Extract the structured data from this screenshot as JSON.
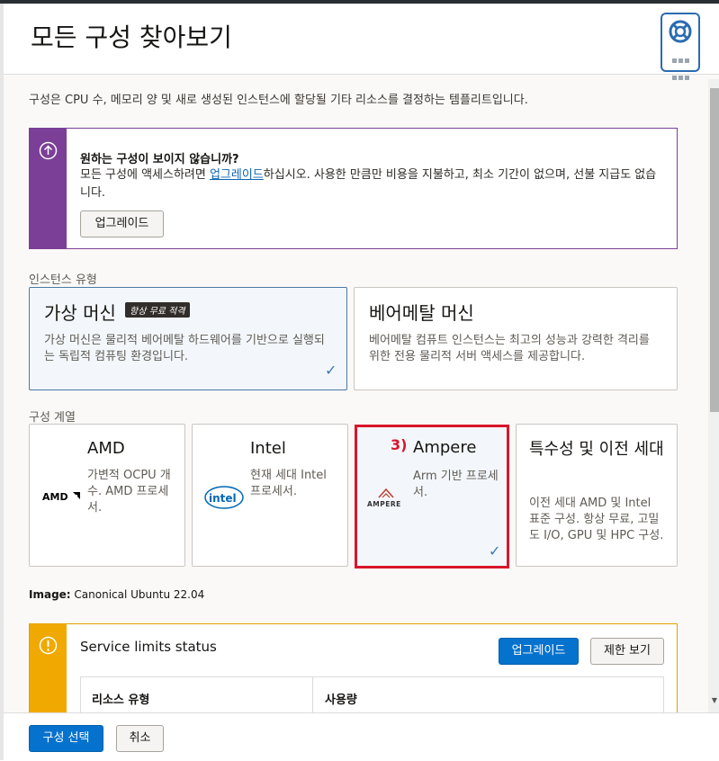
{
  "header": {
    "title": "모든 구성 찾아보기",
    "help_icon": "lifebuoy-icon"
  },
  "description": "구성은 CPU 수, 메모리 양 및 새로 생성된 인스턴스에 할당될 기타 리소스를 결정하는 템플리트입니다.",
  "upsell": {
    "icon": "arrow-up-circle-icon",
    "title": "원하는 구성이 보이지 않습니까?",
    "body_prefix": "모든 구성에 액세스하려면 ",
    "link_text": "업그레이드",
    "body_suffix": "하십시오. 사용한 만큼만 비용을 지불하고, 최소 기간이 없으며, 선불 지급도 없습니다.",
    "button_label": "업그레이드",
    "accent": "#7b3f97"
  },
  "instance_type": {
    "label": "인스턴스 유형",
    "options": [
      {
        "title": "가상 머신",
        "badge": "항상 무료 적격",
        "description": "가상 머신은 물리적 베어메탈 하드웨어를 기반으로 실행되는 독립적 컴퓨팅 환경입니다.",
        "selected": true
      },
      {
        "title": "베어메탈 머신",
        "description": "베어메탈 컴퓨트 인스턴스는 최고의 성능과 강력한 격리를 위한 전용 물리적 서버 액세스를 제공합니다.",
        "selected": false
      }
    ]
  },
  "shape_series": {
    "label": "구성 계열",
    "options": [
      {
        "title": "AMD",
        "logo_text": "AMD",
        "description": "가변적 OCPU 개수. AMD 프로세서.",
        "selected": false
      },
      {
        "title": "Intel",
        "logo_text": "intel",
        "description": "현재 세대 Intel 프로세서.",
        "selected": false
      },
      {
        "title": "Ampere",
        "step": "3)",
        "logo_text": "AMPERE",
        "description": "Arm 기반 프로세서.",
        "selected": true
      },
      {
        "title": "특수성 및 이전 세대",
        "description": "이전 세대 AMD 및 Intel 표준 구성. 항상 무료, 고밀도 I/O, GPU 및 HPC 구성.",
        "selected": false
      }
    ]
  },
  "image": {
    "label": "Image:",
    "value": "Canonical Ubuntu 22.04"
  },
  "service_limits": {
    "icon": "warning-circle-icon",
    "title": "Service limits status",
    "upgrade_label": "업그레이드",
    "view_limits_label": "제한 보기",
    "columns": [
      "리소스 유형",
      "사용량"
    ],
    "accent": "#f0a900"
  },
  "footer": {
    "select_label": "구성 선택",
    "cancel_label": "취소"
  },
  "colors": {
    "primary": "#0572ce",
    "highlight": "#d9162b",
    "check": "#3a79b8"
  }
}
